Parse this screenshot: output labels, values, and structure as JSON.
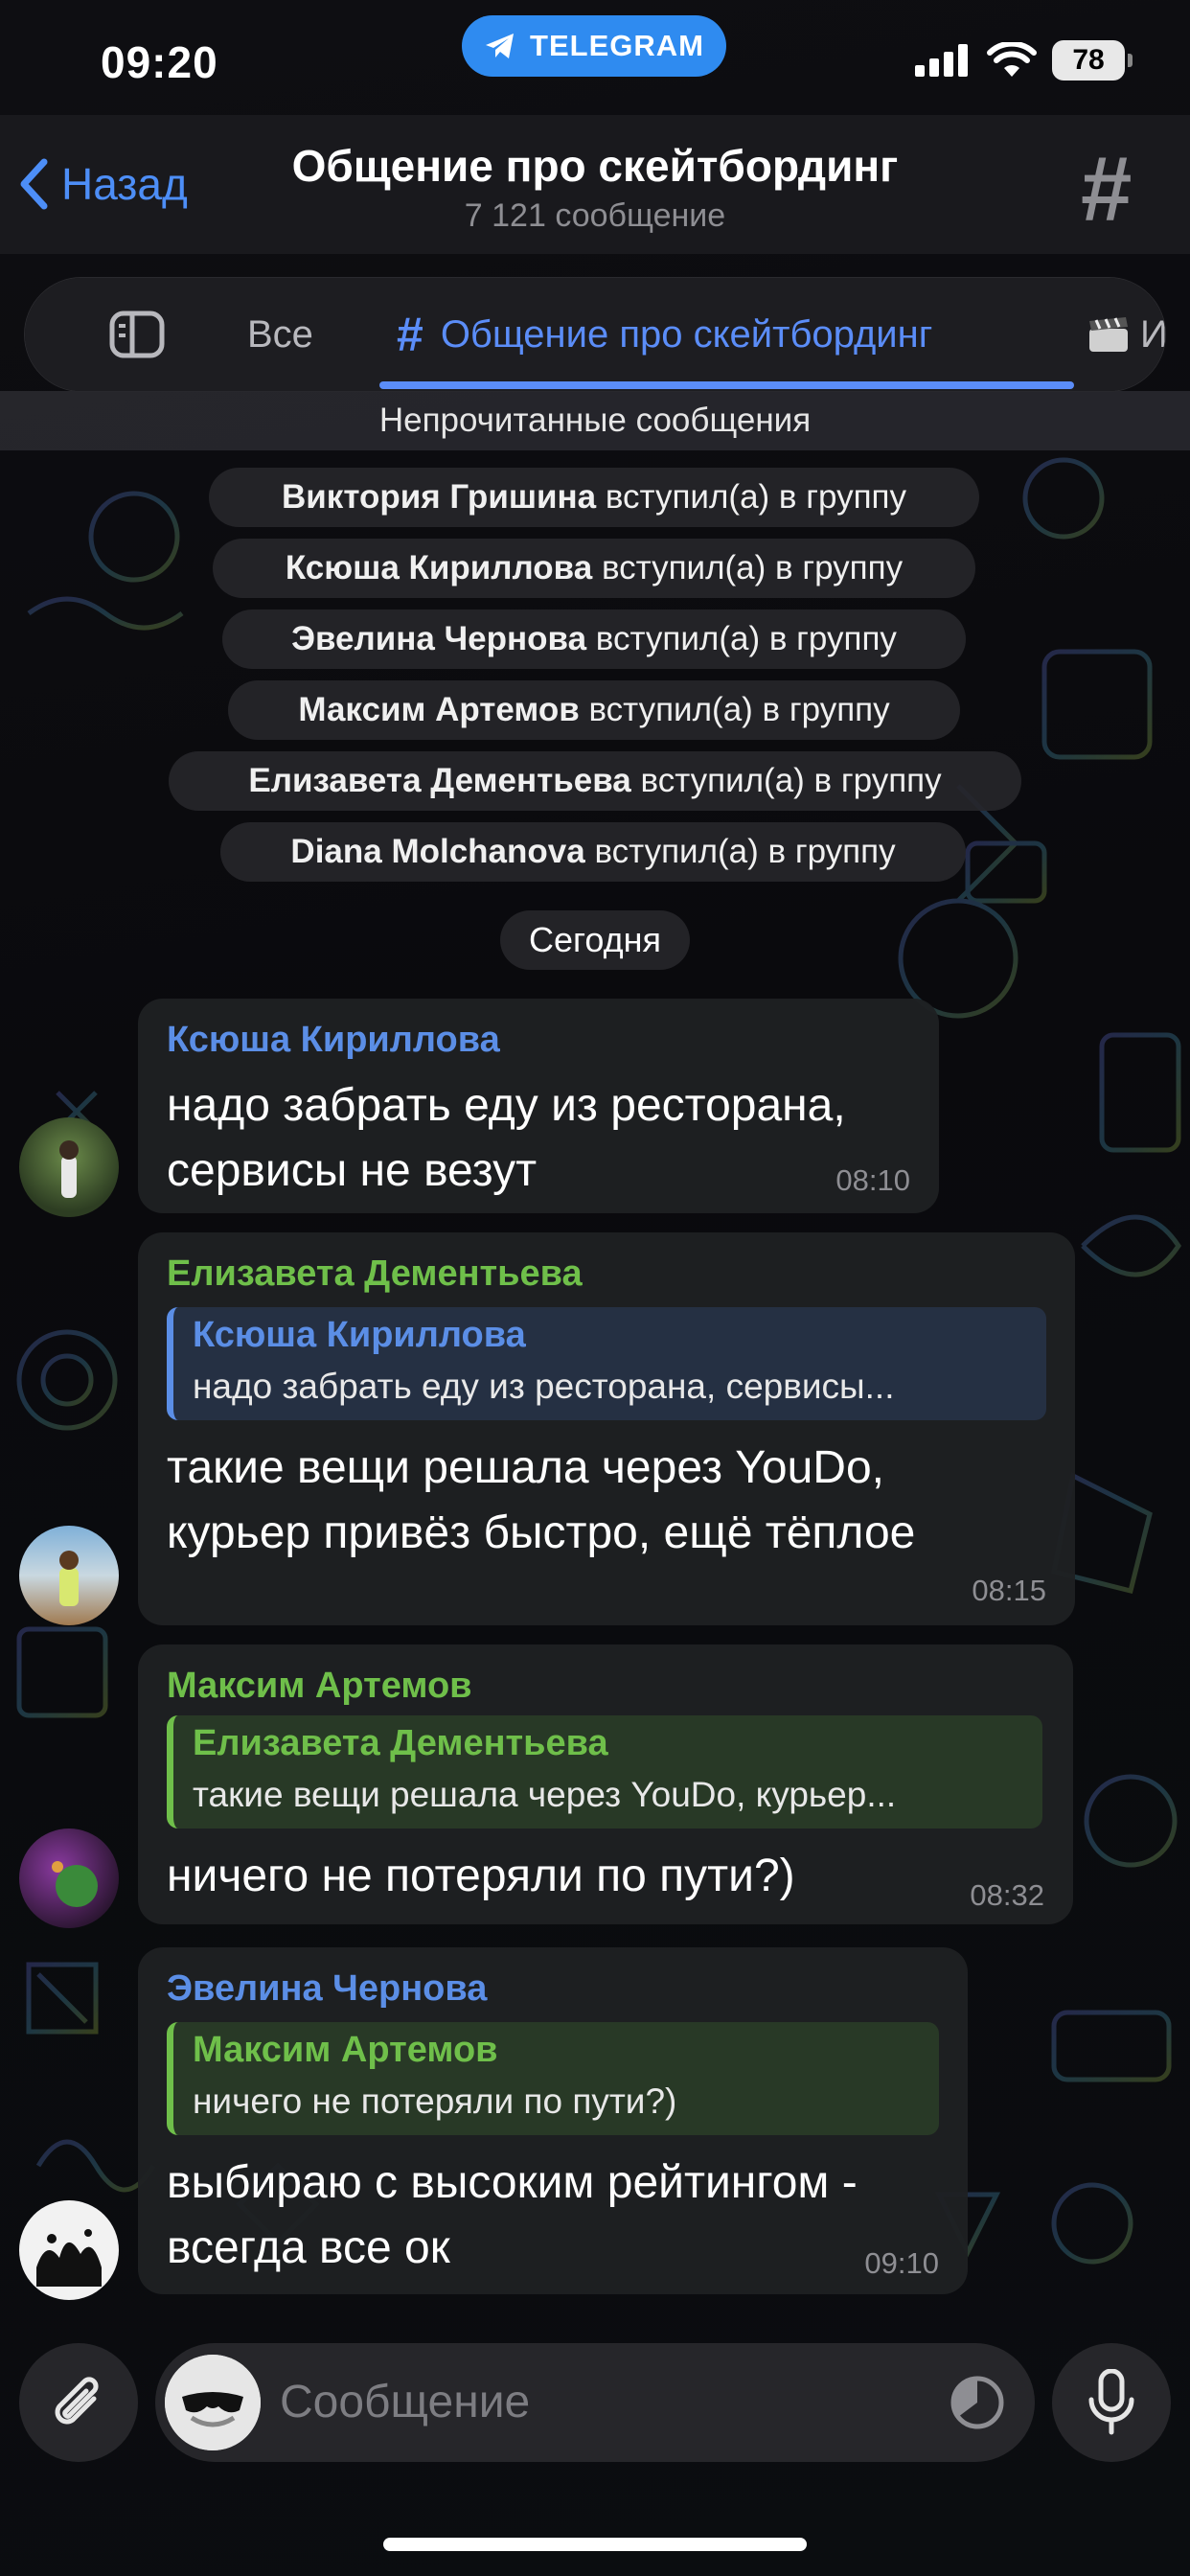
{
  "status_bar": {
    "time": "09:20",
    "app_pill": "TELEGRAM",
    "battery": "78"
  },
  "header": {
    "back_label": "Назад",
    "title": "Общение про скейтбординг",
    "subtitle": "7 121 сообщение"
  },
  "tabs": [
    {
      "label": "Все"
    },
    {
      "label": "Общение про скейтбординг"
    },
    {
      "label": "И"
    }
  ],
  "unread_label": "Непрочитанные сообщения",
  "service": {
    "joined_suffix": "вступил(а) в группу",
    "joined": [
      "Виктория Гришина",
      "Ксюша Кириллова",
      "Эвелина Чернова",
      "Максим Артемов",
      "Елизавета Дементьева",
      "Diana Molchanova"
    ]
  },
  "date_separator": "Сегодня",
  "messages": [
    {
      "sender": "Ксюша Кириллова",
      "lines": [
        "надо забрать еду из ресторана,",
        "сервисы не везут"
      ],
      "time": "08:10"
    },
    {
      "sender": "Елизавета Дементьева",
      "reply": {
        "name": "Ксюша Кириллова",
        "text": "надо забрать еду из ресторана, сервисы..."
      },
      "lines": [
        "такие вещи решала через YouDo,",
        "курьер привёз быстро, ещё тёплое"
      ],
      "time": "08:15"
    },
    {
      "sender": "Максим Артемов",
      "reply": {
        "name": "Елизавета Дементьева",
        "text": "такие вещи решала через YouDo, курьер..."
      },
      "lines": [
        "ничего не потеряли по пути?)"
      ],
      "time": "08:32"
    },
    {
      "sender": "Эвелина Чернова",
      "reply": {
        "name": "Максим Артемов",
        "text": "ничего не потеряли по пути?)"
      },
      "lines": [
        "выбираю с высоким рейтингом -",
        "всегда все ок"
      ],
      "time": "09:10"
    }
  ],
  "composer": {
    "placeholder": "Сообщение"
  },
  "colors": {
    "accent": "#5b8df8",
    "telegram_blue": "#2f8bf0",
    "name_blue": "#5b8ee6",
    "name_green": "#6fbf4a"
  }
}
